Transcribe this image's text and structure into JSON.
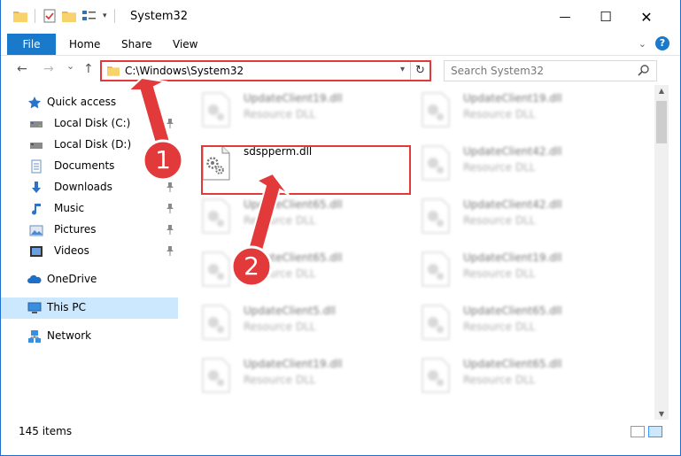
{
  "titlebar": {
    "title": "System32",
    "minimize": "—",
    "maximize": "☐",
    "close": "✕"
  },
  "ribbon": {
    "tabs": [
      "File",
      "Home",
      "Share",
      "View"
    ]
  },
  "nav": {
    "back": "←",
    "forward": "→",
    "recent": "⌄",
    "up": "↑",
    "address": "C:\\Windows\\System32",
    "search_placeholder": "Search System32"
  },
  "sidebar": {
    "items": [
      {
        "label": "Quick access",
        "icon": "star-icon"
      },
      {
        "label": "Local Disk (C:)",
        "icon": "drive-icon",
        "pinned": true
      },
      {
        "label": "Local Disk (D:)",
        "icon": "drive-icon"
      },
      {
        "label": "Documents",
        "icon": "documents-icon",
        "pinned": true
      },
      {
        "label": "Downloads",
        "icon": "downloads-icon",
        "pinned": true
      },
      {
        "label": "Music",
        "icon": "music-icon",
        "pinned": true
      },
      {
        "label": "Pictures",
        "icon": "pictures-icon",
        "pinned": true
      },
      {
        "label": "Videos",
        "icon": "videos-icon",
        "pinned": true
      },
      {
        "label": "OneDrive",
        "icon": "onedrive-icon"
      },
      {
        "label": "This PC",
        "icon": "this-pc-icon",
        "selected": true
      },
      {
        "label": "Network",
        "icon": "network-icon"
      }
    ]
  },
  "files": [
    {
      "name": "UpdateClient19.dll",
      "type": "Resource DLL"
    },
    {
      "name": "UpdateClient19.dll",
      "type": "Resource DLL"
    },
    {
      "name": "sdspperm.dll",
      "type": ""
    },
    {
      "name": "UpdateClient42.dll",
      "type": "Resource DLL"
    },
    {
      "name": "UpdateClient65.dll",
      "type": "Resource DLL"
    },
    {
      "name": "UpdateClient42.dll",
      "type": "Resource DLL"
    },
    {
      "name": "UpdateClient65.dll",
      "type": "Resource DLL"
    },
    {
      "name": "UpdateClient19.dll",
      "type": "Resource DLL"
    },
    {
      "name": "UpdateClient5.dll",
      "type": "Resource DLL"
    },
    {
      "name": "UpdateClient65.dll",
      "type": "Resource DLL"
    },
    {
      "name": "UpdateClient19.dll",
      "type": "Resource DLL"
    },
    {
      "name": "UpdateClient65.dll",
      "type": "Resource DLL"
    }
  ],
  "status": {
    "count": "145 items"
  },
  "annotations": {
    "badge1": "1",
    "badge2": "2",
    "color": "#e23a3a"
  },
  "colors": {
    "accent": "#1979ca",
    "selected_bg": "#cce8ff",
    "highlight": "#e23a3a"
  }
}
